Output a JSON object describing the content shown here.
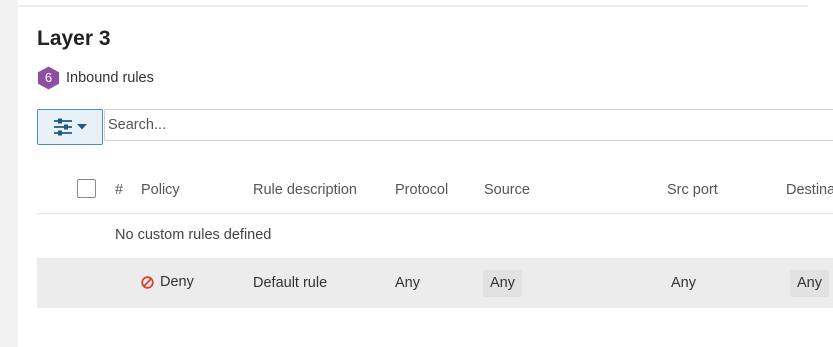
{
  "section": {
    "title": "Layer 3",
    "rule_count": "6",
    "rule_count_label": "Inbound rules"
  },
  "filter": {
    "icon": "sliders-icon",
    "dropdown_icon": "caret-down-icon",
    "search_placeholder": "Search..."
  },
  "table": {
    "columns": {
      "number": "#",
      "policy": "Policy",
      "description": "Rule description",
      "protocol": "Protocol",
      "source": "Source",
      "src_port": "Src port",
      "destination": "Destination"
    },
    "empty_message": "No custom rules defined",
    "default_rule": {
      "policy": "Deny",
      "policy_icon": "deny-icon",
      "description": "Default rule",
      "protocol": "Any",
      "source": "Any",
      "src_port": "Any",
      "destination": "Any"
    }
  },
  "colors": {
    "badge": "#8e4fa3",
    "deny": "#d9442f",
    "accent": "#4a8ec2"
  }
}
